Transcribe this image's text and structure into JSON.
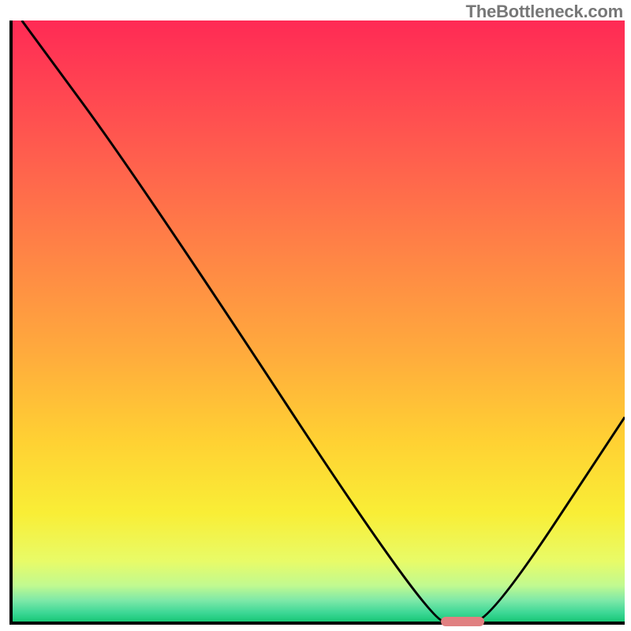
{
  "attribution": "TheBottleneck.com",
  "chart_data": {
    "type": "line",
    "title": "",
    "xlabel": "",
    "ylabel": "",
    "xlim": [
      0,
      100
    ],
    "ylim": [
      0,
      100
    ],
    "x": [
      1.5,
      21,
      68,
      73,
      78,
      100
    ],
    "values": [
      100,
      73,
      0,
      0,
      0,
      34
    ],
    "marker": {
      "x_start": 70,
      "x_end": 77,
      "y": 0
    },
    "gradient_stops": [
      {
        "offset": 0,
        "color": "#ff2a55"
      },
      {
        "offset": 0.07,
        "color": "#ff3a53"
      },
      {
        "offset": 0.22,
        "color": "#ff5d4e"
      },
      {
        "offset": 0.4,
        "color": "#ff8745"
      },
      {
        "offset": 0.55,
        "color": "#ffaa3d"
      },
      {
        "offset": 0.7,
        "color": "#ffd133"
      },
      {
        "offset": 0.82,
        "color": "#f9ee36"
      },
      {
        "offset": 0.9,
        "color": "#e8fb68"
      },
      {
        "offset": 0.94,
        "color": "#c1fa90"
      },
      {
        "offset": 0.965,
        "color": "#7de8a8"
      },
      {
        "offset": 0.985,
        "color": "#3ed896"
      },
      {
        "offset": 1.0,
        "color": "#18c877"
      }
    ]
  },
  "colors": {
    "axis": "#000000",
    "curve": "#000000",
    "marker": "#e08081",
    "attribution_text": "#777777"
  }
}
